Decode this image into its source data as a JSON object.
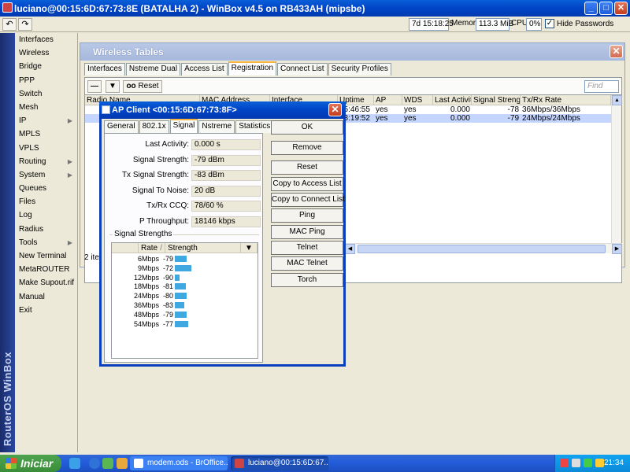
{
  "titlebar": {
    "title": "luciano@00:15:6D:67:73:8E (BATALHA 2) - WinBox v4.5 on RB433AH (mipsbe)",
    "min": "_",
    "max": "□",
    "close": "✕"
  },
  "toolbar": {
    "undo": "↶",
    "redo": "↷",
    "uptime": "7d 15:18:25",
    "memory_label": "Memory:",
    "memory_value": "113.3 MiB",
    "cpu_label": "CPU:",
    "cpu_value": "0%",
    "hide_passwords_label": "Hide Passwords",
    "hide_passwords_checked": "✓"
  },
  "sidebar": {
    "brand": "RouterOS WinBox",
    "items": [
      {
        "label": "Interfaces"
      },
      {
        "label": "Wireless"
      },
      {
        "label": "Bridge"
      },
      {
        "label": "PPP"
      },
      {
        "label": "Switch"
      },
      {
        "label": "Mesh"
      },
      {
        "label": "IP",
        "arrow": "▶"
      },
      {
        "label": "MPLS"
      },
      {
        "label": "VPLS"
      },
      {
        "label": "Routing",
        "arrow": "▶"
      },
      {
        "label": "System",
        "arrow": "▶"
      },
      {
        "label": "Queues"
      },
      {
        "label": "Files"
      },
      {
        "label": "Log"
      },
      {
        "label": "Radius"
      },
      {
        "label": "Tools",
        "arrow": "▶"
      },
      {
        "label": "New Terminal"
      },
      {
        "label": "MetaROUTER"
      },
      {
        "label": "Make Supout.rif"
      },
      {
        "label": "Manual"
      },
      {
        "label": "Exit"
      }
    ]
  },
  "wireless_tables": {
    "title": "Wireless Tables",
    "close": "✕",
    "tabs": [
      "Interfaces",
      "Nstreme Dual",
      "Access List",
      "Registration",
      "Connect List",
      "Security Profiles"
    ],
    "remove_icon": "—",
    "filter_icon": "▼",
    "reset_counters_label": "Reset",
    "reset_counters_prefix": "oo",
    "find_placeholder": "Find",
    "columns": [
      "Radio Name",
      "MAC Address",
      "Interface",
      "Uptime",
      "AP",
      "WDS",
      "Last Activit...",
      "Signal Strengt...",
      "Tx/Rx Rate"
    ],
    "rows": [
      {
        "uptime": "05:46:55",
        "ap": "yes",
        "wds": "yes",
        "last_activity": "0.000",
        "signal": "-78",
        "rate": "36Mbps/36Mbps"
      },
      {
        "uptime": "03:19:52",
        "ap": "yes",
        "wds": "yes",
        "last_activity": "0.000",
        "signal": "-79",
        "rate": "24Mbps/24Mbps"
      }
    ],
    "status": "2 item"
  },
  "ap_client": {
    "title": "AP Client <00:15:6D:67:73:8F>",
    "close": "✕",
    "tabs": [
      "General",
      "802.1x",
      "Signal",
      "Nstreme",
      "Statistics"
    ],
    "fields": [
      {
        "label": "Last Activity:",
        "value": "0.000 s"
      },
      {
        "label": "Signal Strength:",
        "value": "-79 dBm"
      },
      {
        "label": "Tx Signal Strength:",
        "value": "-83 dBm"
      },
      {
        "label": "Signal To Noise:",
        "value": "20 dB"
      },
      {
        "label": "Tx/Rx CCQ:",
        "value": "78/60 %"
      },
      {
        "label": "P Throughput:",
        "value": "18146 kbps"
      }
    ],
    "signal_strengths_label": "Signal Strengths",
    "ss_columns": [
      "Rate",
      "Strength"
    ],
    "ss_sort_icon": "/",
    "ss_menu_icon": "▼",
    "signal_strengths": [
      {
        "rate": "6Mbps",
        "strength": "-79",
        "level": 0.55
      },
      {
        "rate": "9Mbps",
        "strength": "-72",
        "level": 0.75
      },
      {
        "rate": "12Mbps",
        "strength": "-90",
        "level": 0.22
      },
      {
        "rate": "18Mbps",
        "strength": "-81",
        "level": 0.5
      },
      {
        "rate": "24Mbps",
        "strength": "-80",
        "level": 0.52
      },
      {
        "rate": "36Mbps",
        "strength": "-83",
        "level": 0.44
      },
      {
        "rate": "48Mbps",
        "strength": "-79",
        "level": 0.55
      },
      {
        "rate": "54Mbps",
        "strength": "-77",
        "level": 0.6
      }
    ],
    "buttons": [
      "OK",
      "Remove",
      "Reset",
      "Copy to Access List",
      "Copy to Connect List",
      "Ping",
      "MAC Ping",
      "Telnet",
      "MAC Telnet",
      "Torch"
    ]
  },
  "taskbar": {
    "start_label": "Iniciar",
    "tasks": [
      "modem.ods - BrOffice....",
      "luciano@00:15:6D:67..."
    ],
    "clock": "21:34"
  },
  "colors": {
    "accent": "#0046c8",
    "signal_bar": "#3fa8e0",
    "selected_row": "#c4d6ff"
  }
}
